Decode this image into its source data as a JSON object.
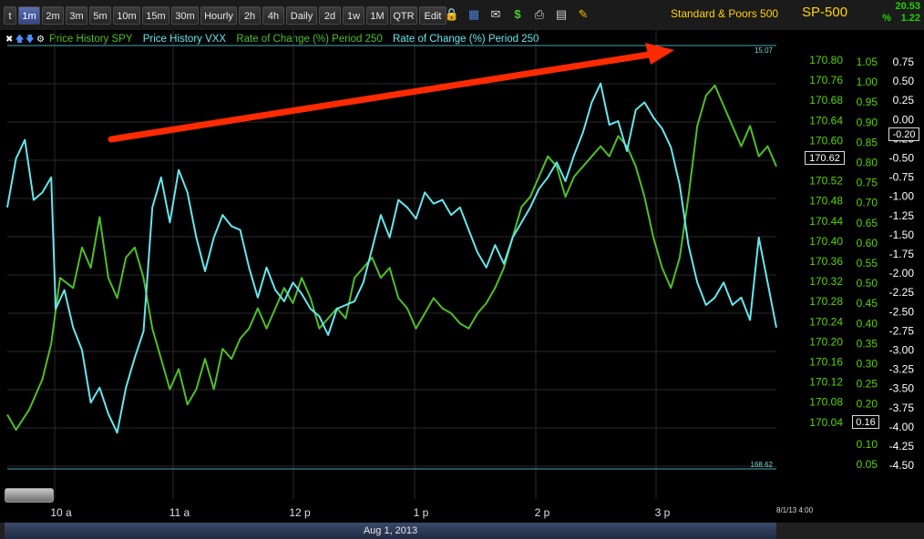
{
  "toolbar": {
    "periods": [
      "t",
      "1m",
      "2m",
      "3m",
      "5m",
      "10m",
      "15m",
      "30m",
      "Hourly",
      "2h",
      "4h",
      "Daily",
      "2d",
      "1w",
      "1M",
      "QTR",
      "Edit"
    ],
    "active_period": "1m",
    "icons": [
      "lock-icon",
      "save-icon",
      "mail-icon",
      "dollar-icon",
      "print-icon",
      "card-icon",
      "pencil-icon"
    ]
  },
  "quote": {
    "name": "Standard & Poors 500",
    "symbol": "SP-500",
    "last": "20.53",
    "pct_symbol": "%",
    "change_pct": "1.22"
  },
  "legend": {
    "controls": [
      "close-icon",
      "up-arrow-icon",
      "down-arrow-icon",
      "pin-icon"
    ],
    "spy": "Price History SPY",
    "vxx": "Price History VXX",
    "roc1": "Rate of Change (%) Period 250",
    "roc2": "Rate of Change (%) Period 250"
  },
  "colors": {
    "spy": "#4fbf26",
    "vxx": "#66e6ee",
    "arrow": "#ff2a00",
    "axis_green": "#59d400",
    "axis_white": "#ffffff",
    "grid": "#2a2a2a"
  },
  "readouts": {
    "top_line": "15.07",
    "bottom_line": "168.62",
    "spy_last": "170.62",
    "roc_last": "-0.20",
    "roc_alt": "0.16"
  },
  "footer": {
    "date": "Aug 1, 2013",
    "datetime": "8/1/13 4:00"
  },
  "chart_data": {
    "type": "line",
    "x_tick_labels": [
      "10 a",
      "11 a",
      "12 p",
      "1 p",
      "2 p",
      "3 p"
    ],
    "x_range": [
      "09:30",
      "16:00"
    ],
    "axes": {
      "spy_price": {
        "ticks": [
          "170.80",
          "170.76",
          "170.68",
          "170.64",
          "170.60",
          "170.56",
          "170.52",
          "170.48",
          "170.44",
          "170.40",
          "170.36",
          "170.32",
          "170.28",
          "170.24",
          "170.20",
          "170.16",
          "170.12",
          "170.08",
          "170.04"
        ],
        "range": [
          170.03,
          170.83
        ]
      },
      "axis_mid": {
        "ticks": [
          "1.05",
          "1.00",
          "0.95",
          "0.90",
          "0.85",
          "0.80",
          "0.75",
          "0.70",
          "0.65",
          "0.60",
          "0.55",
          "0.50",
          "0.45",
          "0.40",
          "0.35",
          "0.30",
          "0.25",
          "0.20",
          "0.15",
          "0.10",
          "0.05"
        ],
        "range": [
          0.03,
          1.08
        ]
      },
      "roc": {
        "ticks": [
          "0.75",
          "0.50",
          "0.25",
          "0.00",
          "-0.25",
          "-0.50",
          "-0.75",
          "-1.00",
          "-1.25",
          "-1.50",
          "-1.75",
          "-2.00",
          "-2.25",
          "-2.50",
          "-2.75",
          "-3.00",
          "-3.25",
          "-3.50",
          "-3.75",
          "-4.00",
          "-4.25",
          "-4.50"
        ],
        "range": [
          -4.5,
          0.75
        ]
      }
    },
    "series": [
      {
        "name": "Price History SPY",
        "axis": "spy_price",
        "points": [
          [
            0,
            170.13
          ],
          [
            4,
            170.1
          ],
          [
            10,
            170.14
          ],
          [
            16,
            170.2
          ],
          [
            20,
            170.27
          ],
          [
            24,
            170.4
          ],
          [
            30,
            170.38
          ],
          [
            34,
            170.46
          ],
          [
            38,
            170.42
          ],
          [
            42,
            170.52
          ],
          [
            46,
            170.4
          ],
          [
            50,
            170.36
          ],
          [
            54,
            170.44
          ],
          [
            58,
            170.46
          ],
          [
            62,
            170.4
          ],
          [
            66,
            170.3
          ],
          [
            70,
            170.24
          ],
          [
            74,
            170.18
          ],
          [
            78,
            170.22
          ],
          [
            82,
            170.15
          ],
          [
            86,
            170.18
          ],
          [
            90,
            170.24
          ],
          [
            94,
            170.18
          ],
          [
            98,
            170.26
          ],
          [
            102,
            170.24
          ],
          [
            106,
            170.28
          ],
          [
            110,
            170.3
          ],
          [
            114,
            170.34
          ],
          [
            118,
            170.3
          ],
          [
            122,
            170.34
          ],
          [
            126,
            170.38
          ],
          [
            130,
            170.35
          ],
          [
            134,
            170.4
          ],
          [
            138,
            170.36
          ],
          [
            142,
            170.3
          ],
          [
            146,
            170.32
          ],
          [
            150,
            170.34
          ],
          [
            154,
            170.32
          ],
          [
            158,
            170.4
          ],
          [
            162,
            170.42
          ],
          [
            166,
            170.44
          ],
          [
            170,
            170.4
          ],
          [
            174,
            170.42
          ],
          [
            178,
            170.36
          ],
          [
            182,
            170.34
          ],
          [
            186,
            170.3
          ],
          [
            190,
            170.33
          ],
          [
            194,
            170.36
          ],
          [
            198,
            170.34
          ],
          [
            202,
            170.33
          ],
          [
            206,
            170.31
          ],
          [
            210,
            170.3
          ],
          [
            214,
            170.33
          ],
          [
            218,
            170.35
          ],
          [
            222,
            170.38
          ],
          [
            226,
            170.42
          ],
          [
            230,
            170.48
          ],
          [
            234,
            170.54
          ],
          [
            238,
            170.56
          ],
          [
            242,
            170.6
          ],
          [
            246,
            170.64
          ],
          [
            250,
            170.62
          ],
          [
            254,
            170.56
          ],
          [
            258,
            170.6
          ],
          [
            262,
            170.62
          ],
          [
            266,
            170.64
          ],
          [
            270,
            170.66
          ],
          [
            274,
            170.64
          ],
          [
            278,
            170.68
          ],
          [
            282,
            170.66
          ],
          [
            286,
            170.62
          ],
          [
            290,
            170.56
          ],
          [
            294,
            170.48
          ],
          [
            298,
            170.42
          ],
          [
            302,
            170.38
          ],
          [
            306,
            170.44
          ],
          [
            310,
            170.56
          ],
          [
            314,
            170.7
          ],
          [
            318,
            170.76
          ],
          [
            322,
            170.78
          ],
          [
            326,
            170.74
          ],
          [
            330,
            170.7
          ],
          [
            334,
            170.66
          ],
          [
            338,
            170.7
          ],
          [
            342,
            170.64
          ],
          [
            346,
            170.66
          ],
          [
            350,
            170.62
          ]
        ]
      },
      {
        "name": "Price History VXX",
        "axis": "roc",
        "points": [
          [
            0,
            -1.2
          ],
          [
            4,
            -0.55
          ],
          [
            8,
            -0.3
          ],
          [
            12,
            -1.1
          ],
          [
            16,
            -1.0
          ],
          [
            20,
            -0.8
          ],
          [
            22,
            -2.55
          ],
          [
            26,
            -2.3
          ],
          [
            30,
            -2.8
          ],
          [
            34,
            -3.1
          ],
          [
            38,
            -3.8
          ],
          [
            42,
            -3.6
          ],
          [
            46,
            -3.95
          ],
          [
            50,
            -4.2
          ],
          [
            54,
            -3.6
          ],
          [
            58,
            -3.2
          ],
          [
            62,
            -2.85
          ],
          [
            66,
            -1.2
          ],
          [
            70,
            -0.8
          ],
          [
            74,
            -1.4
          ],
          [
            78,
            -0.7
          ],
          [
            82,
            -1.0
          ],
          [
            86,
            -1.6
          ],
          [
            90,
            -2.05
          ],
          [
            94,
            -1.6
          ],
          [
            98,
            -1.3
          ],
          [
            102,
            -1.45
          ],
          [
            106,
            -1.5
          ],
          [
            110,
            -2.0
          ],
          [
            114,
            -2.4
          ],
          [
            118,
            -2.0
          ],
          [
            122,
            -2.3
          ],
          [
            126,
            -2.45
          ],
          [
            130,
            -2.2
          ],
          [
            134,
            -2.35
          ],
          [
            138,
            -2.55
          ],
          [
            142,
            -2.65
          ],
          [
            146,
            -2.9
          ],
          [
            150,
            -2.55
          ],
          [
            154,
            -2.5
          ],
          [
            158,
            -2.45
          ],
          [
            162,
            -2.2
          ],
          [
            166,
            -1.75
          ],
          [
            170,
            -1.3
          ],
          [
            174,
            -1.6
          ],
          [
            178,
            -1.1
          ],
          [
            182,
            -1.2
          ],
          [
            186,
            -1.35
          ],
          [
            190,
            -1.0
          ],
          [
            194,
            -1.15
          ],
          [
            198,
            -1.1
          ],
          [
            202,
            -1.3
          ],
          [
            206,
            -1.2
          ],
          [
            210,
            -1.5
          ],
          [
            214,
            -1.8
          ],
          [
            218,
            -2.0
          ],
          [
            222,
            -1.7
          ],
          [
            226,
            -1.95
          ],
          [
            230,
            -1.6
          ],
          [
            234,
            -1.4
          ],
          [
            238,
            -1.2
          ],
          [
            242,
            -0.95
          ],
          [
            246,
            -0.8
          ],
          [
            250,
            -0.6
          ],
          [
            254,
            -0.85
          ],
          [
            258,
            -0.5
          ],
          [
            262,
            -0.2
          ],
          [
            266,
            0.2
          ],
          [
            270,
            0.45
          ],
          [
            274,
            -0.1
          ],
          [
            278,
            -0.05
          ],
          [
            282,
            -0.45
          ],
          [
            286,
            0.1
          ],
          [
            290,
            0.2
          ],
          [
            294,
            0.0
          ],
          [
            298,
            -0.15
          ],
          [
            302,
            -0.4
          ],
          [
            306,
            -0.9
          ],
          [
            310,
            -1.7
          ],
          [
            314,
            -2.2
          ],
          [
            318,
            -2.5
          ],
          [
            322,
            -2.4
          ],
          [
            326,
            -2.2
          ],
          [
            330,
            -2.5
          ],
          [
            334,
            -2.4
          ],
          [
            338,
            -2.7
          ],
          [
            342,
            -1.6
          ],
          [
            346,
            -2.2
          ],
          [
            350,
            -2.8
          ]
        ]
      }
    ]
  }
}
